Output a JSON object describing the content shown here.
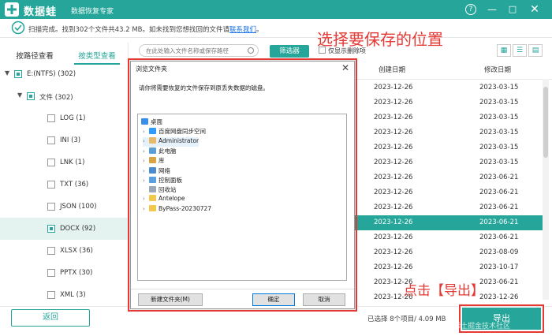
{
  "app": {
    "name": "数据蛙",
    "subtitle": "数据恢复专家"
  },
  "window": {
    "help_icon": "?",
    "min_icon": "—",
    "max_icon": "□",
    "close_icon": "✕"
  },
  "status": {
    "text": "扫描完成。找到302个文件共43.2 MB。如未找到您想找回的文件请",
    "link": "联系我们",
    "link_tail": "。"
  },
  "tabs": {
    "by_path": "按路径查看",
    "by_type": "按类型查看"
  },
  "tree": [
    {
      "label": "E:(NTFS) (302)",
      "level": 0,
      "caret": "▼",
      "check": "partial"
    },
    {
      "label": "文件 (302)",
      "level": 1,
      "caret": "▼",
      "check": "partial"
    },
    {
      "label": "LOG (1)",
      "level": 2,
      "caret": "",
      "check": "none"
    },
    {
      "label": "INI (3)",
      "level": 2,
      "caret": "",
      "check": "none"
    },
    {
      "label": "LNK (1)",
      "level": 2,
      "caret": "",
      "check": "none"
    },
    {
      "label": "TXT (36)",
      "level": 2,
      "caret": "",
      "check": "none"
    },
    {
      "label": "JSON (100)",
      "level": 2,
      "caret": "",
      "check": "none"
    },
    {
      "label": "DOCX (92)",
      "level": 2,
      "caret": "",
      "check": "partial",
      "selected": true
    },
    {
      "label": "XLSX (36)",
      "level": 2,
      "caret": "",
      "check": "none"
    },
    {
      "label": "PPTX (30)",
      "level": 2,
      "caret": "",
      "check": "none"
    },
    {
      "label": "XML (3)",
      "level": 2,
      "caret": "",
      "check": "none"
    }
  ],
  "toolbar": {
    "search_placeholder": "在此处输入文件名称或保存路径",
    "filter_label": "筛选器",
    "deleted_only_label": "仅显示删除项"
  },
  "table": {
    "col_created": "创建日期",
    "col_modified": "修改日期",
    "rows": [
      {
        "created": "2023-12-26",
        "modified": "2023-03-15",
        "selected": false
      },
      {
        "created": "2023-12-26",
        "modified": "2023-03-15",
        "selected": false
      },
      {
        "created": "2023-12-26",
        "modified": "2023-03-15",
        "selected": false
      },
      {
        "created": "2023-12-26",
        "modified": "2023-03-15",
        "selected": false
      },
      {
        "created": "2023-12-26",
        "modified": "2023-03-15",
        "selected": false
      },
      {
        "created": "2023-12-26",
        "modified": "2023-03-15",
        "selected": false
      },
      {
        "created": "2023-12-26",
        "modified": "2023-06-21",
        "selected": false
      },
      {
        "created": "2023-12-26",
        "modified": "2023-06-21",
        "selected": false
      },
      {
        "created": "2023-12-26",
        "modified": "2023-06-21",
        "selected": false
      },
      {
        "created": "2023-12-26",
        "modified": "2023-06-21",
        "selected": true
      },
      {
        "created": "2023-12-26",
        "modified": "2023-06-21",
        "selected": false
      },
      {
        "created": "2023-12-26",
        "modified": "2023-08-09",
        "selected": false
      },
      {
        "created": "2023-12-26",
        "modified": "2023-10-17",
        "selected": false
      },
      {
        "created": "2023-12-26",
        "modified": "2023-06-21",
        "selected": false
      },
      {
        "created": "2023-12-26",
        "modified": "2023-12-26",
        "selected": false
      },
      {
        "created": "2023-12-26",
        "modified": "2023-12-26",
        "selected": false
      }
    ]
  },
  "bottom": {
    "back_label": "返回",
    "selection_info": "已选择 8个项目/ 4.09 MB",
    "export_label": "导出",
    "watermark": "@稀土掘金技术社区"
  },
  "annotations": {
    "save_location": "选择要保存的位置",
    "click_export": "点击【导出】"
  },
  "dialog": {
    "title": "浏览文件夹",
    "close_icon": "✕",
    "prompt": "请你将需要恢复的文件保存到原丢失数据的磁盘。",
    "items": [
      {
        "label": "桌面",
        "caret": "",
        "icon": "desktop-icon",
        "color": "#3a8ee6",
        "indent": 0
      },
      {
        "label": "百度网盘同步空间",
        "caret": "›",
        "icon": "baidu-netdisk-icon",
        "color": "#2f9bff",
        "indent": 1
      },
      {
        "label": "Administrator",
        "caret": "›",
        "icon": "user-icon",
        "color": "#e8b96a",
        "indent": 1,
        "selected": true
      },
      {
        "label": "此电脑",
        "caret": "›",
        "icon": "computer-icon",
        "color": "#5a9fd6",
        "indent": 1
      },
      {
        "label": "库",
        "caret": "›",
        "icon": "library-icon",
        "color": "#d9a441",
        "indent": 1
      },
      {
        "label": "网络",
        "caret": "›",
        "icon": "network-icon",
        "color": "#4a8bd0",
        "indent": 1
      },
      {
        "label": "控制面板",
        "caret": "›",
        "icon": "control-panel-icon",
        "color": "#5aa0e0",
        "indent": 1
      },
      {
        "label": "回收站",
        "caret": "",
        "icon": "recycle-bin-icon",
        "color": "#9aa8b8",
        "indent": 1
      },
      {
        "label": "Antelope",
        "caret": "›",
        "icon": "folder-icon",
        "color": "#f2c94c",
        "indent": 1
      },
      {
        "label": "ByPass-20230727",
        "caret": "›",
        "icon": "folder-icon",
        "color": "#f2c94c",
        "indent": 1
      }
    ],
    "new_folder_label": "新建文件夹(M)",
    "ok_label": "确定",
    "cancel_label": "取消"
  },
  "colors": {
    "accent": "#26a69a",
    "annotation": "#e53935"
  }
}
